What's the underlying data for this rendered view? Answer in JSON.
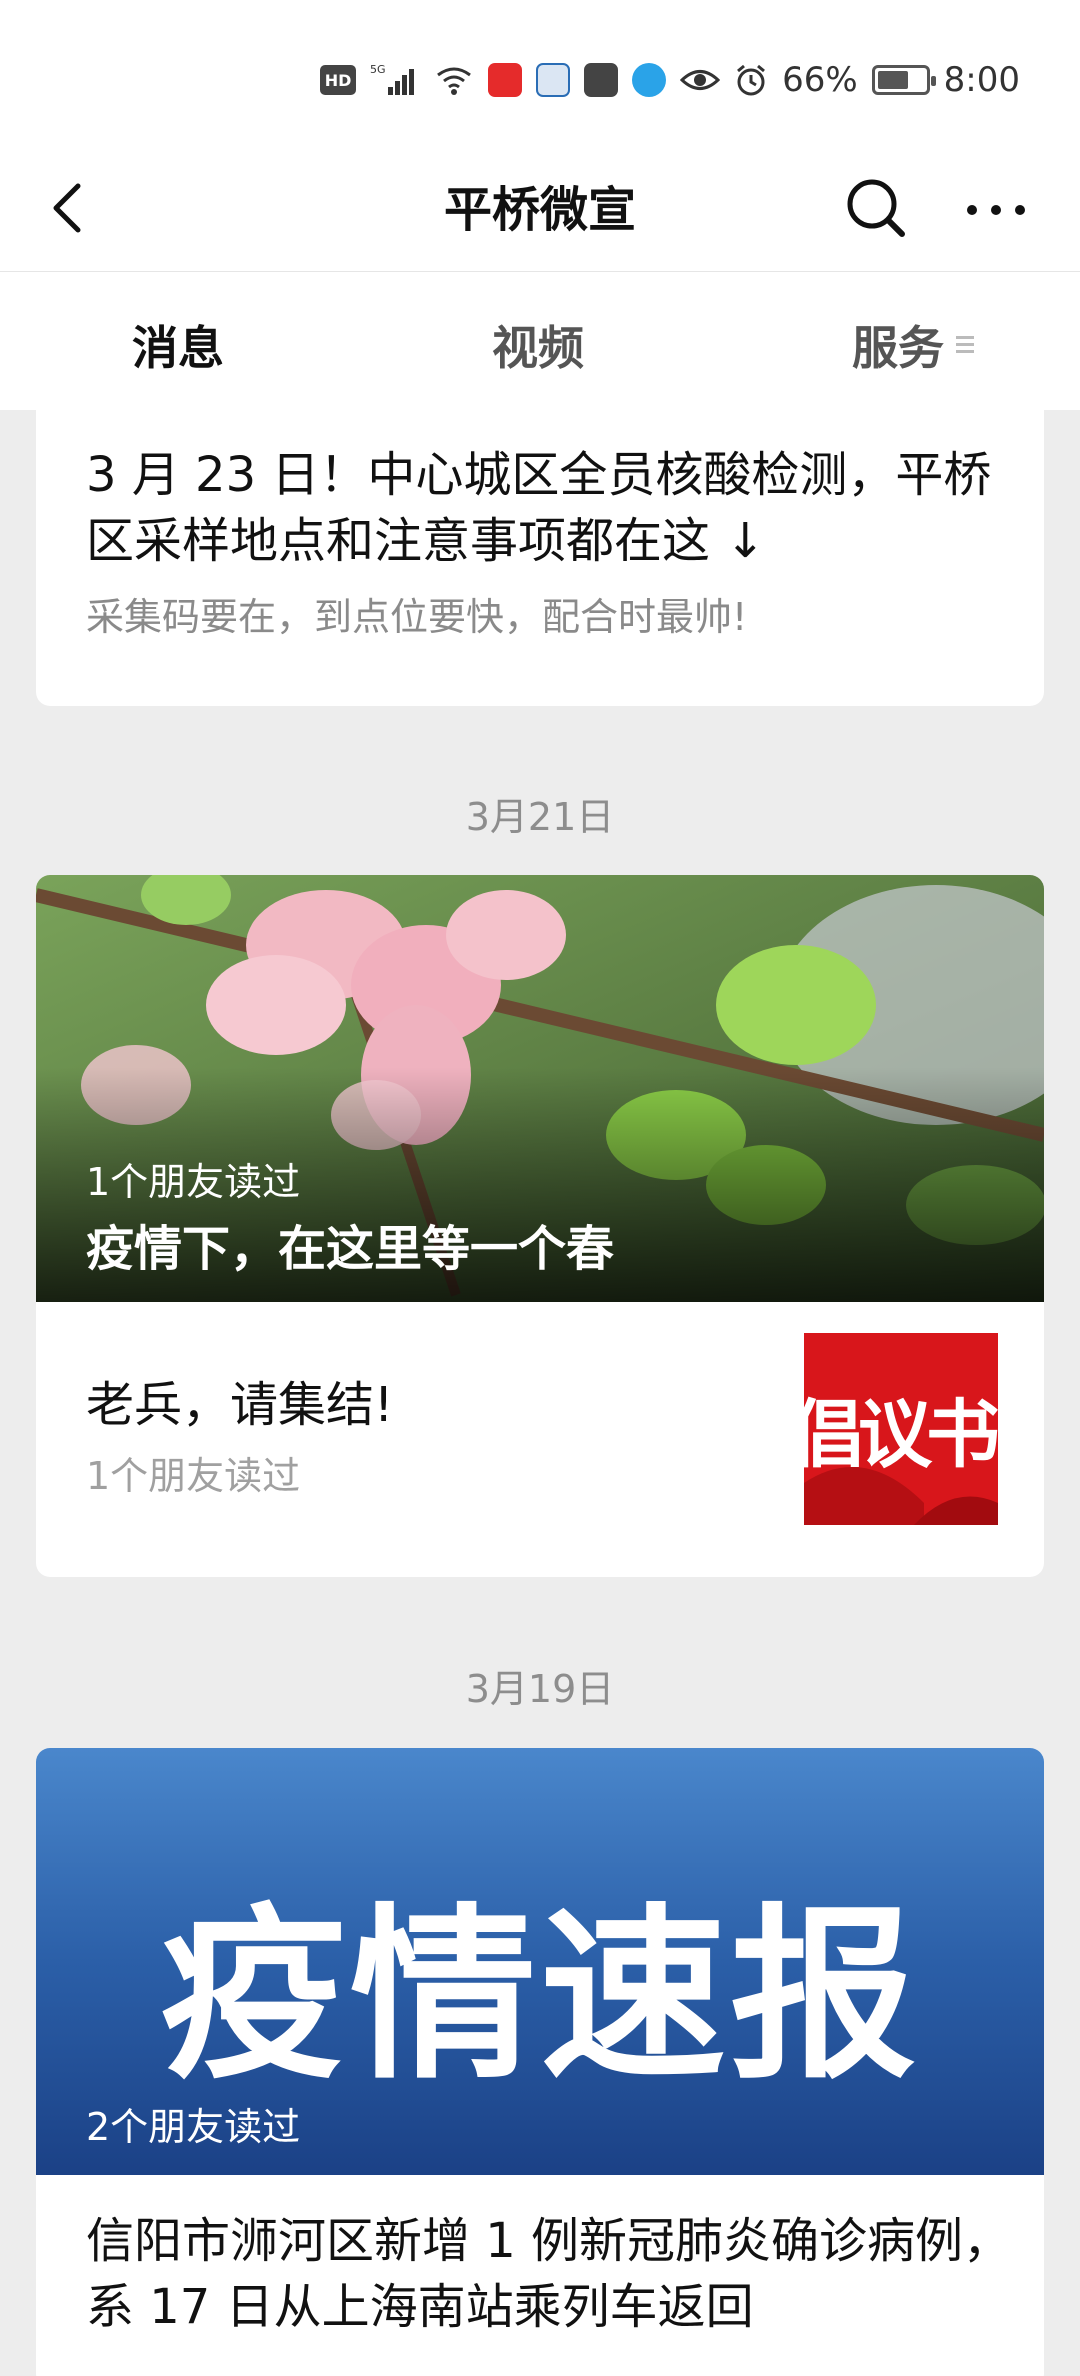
{
  "status_bar": {
    "hd": "HD",
    "signal": "5G",
    "battery_percent": "66%",
    "battery_level": 0.66,
    "time": "8:00"
  },
  "nav": {
    "title": "平桥微宣",
    "back_icon": "chevron-left-icon",
    "search_icon": "search-icon",
    "more_icon": "more-horizontal-icon"
  },
  "tabs": [
    {
      "label": "消息",
      "active": true
    },
    {
      "label": "视频",
      "active": false
    },
    {
      "label": "服务",
      "active": false
    }
  ],
  "articles": [
    {
      "title": "3 月 23 日！中心城区全员核酸检测，平桥区采样地点和注意事项都在这 ↓",
      "digest": "采集码要在，到点位要快，配合时最帅!"
    }
  ],
  "groups": [
    {
      "date": "3月21日",
      "hero": {
        "readers": "1个朋友读过",
        "title": "疫情下，在这里等一个春"
      },
      "sub": {
        "title": "老兵，请集结!",
        "readers": "1个朋友读过",
        "thumb_text": "倡议书"
      }
    },
    {
      "date": "3月19日",
      "hero": {
        "banner_text": "疫情速报",
        "readers": "2个朋友读过"
      },
      "title": "信阳市浉河区新增 1 例新冠肺炎确诊病例，系 17 日从上海南站乘列车返回"
    }
  ]
}
